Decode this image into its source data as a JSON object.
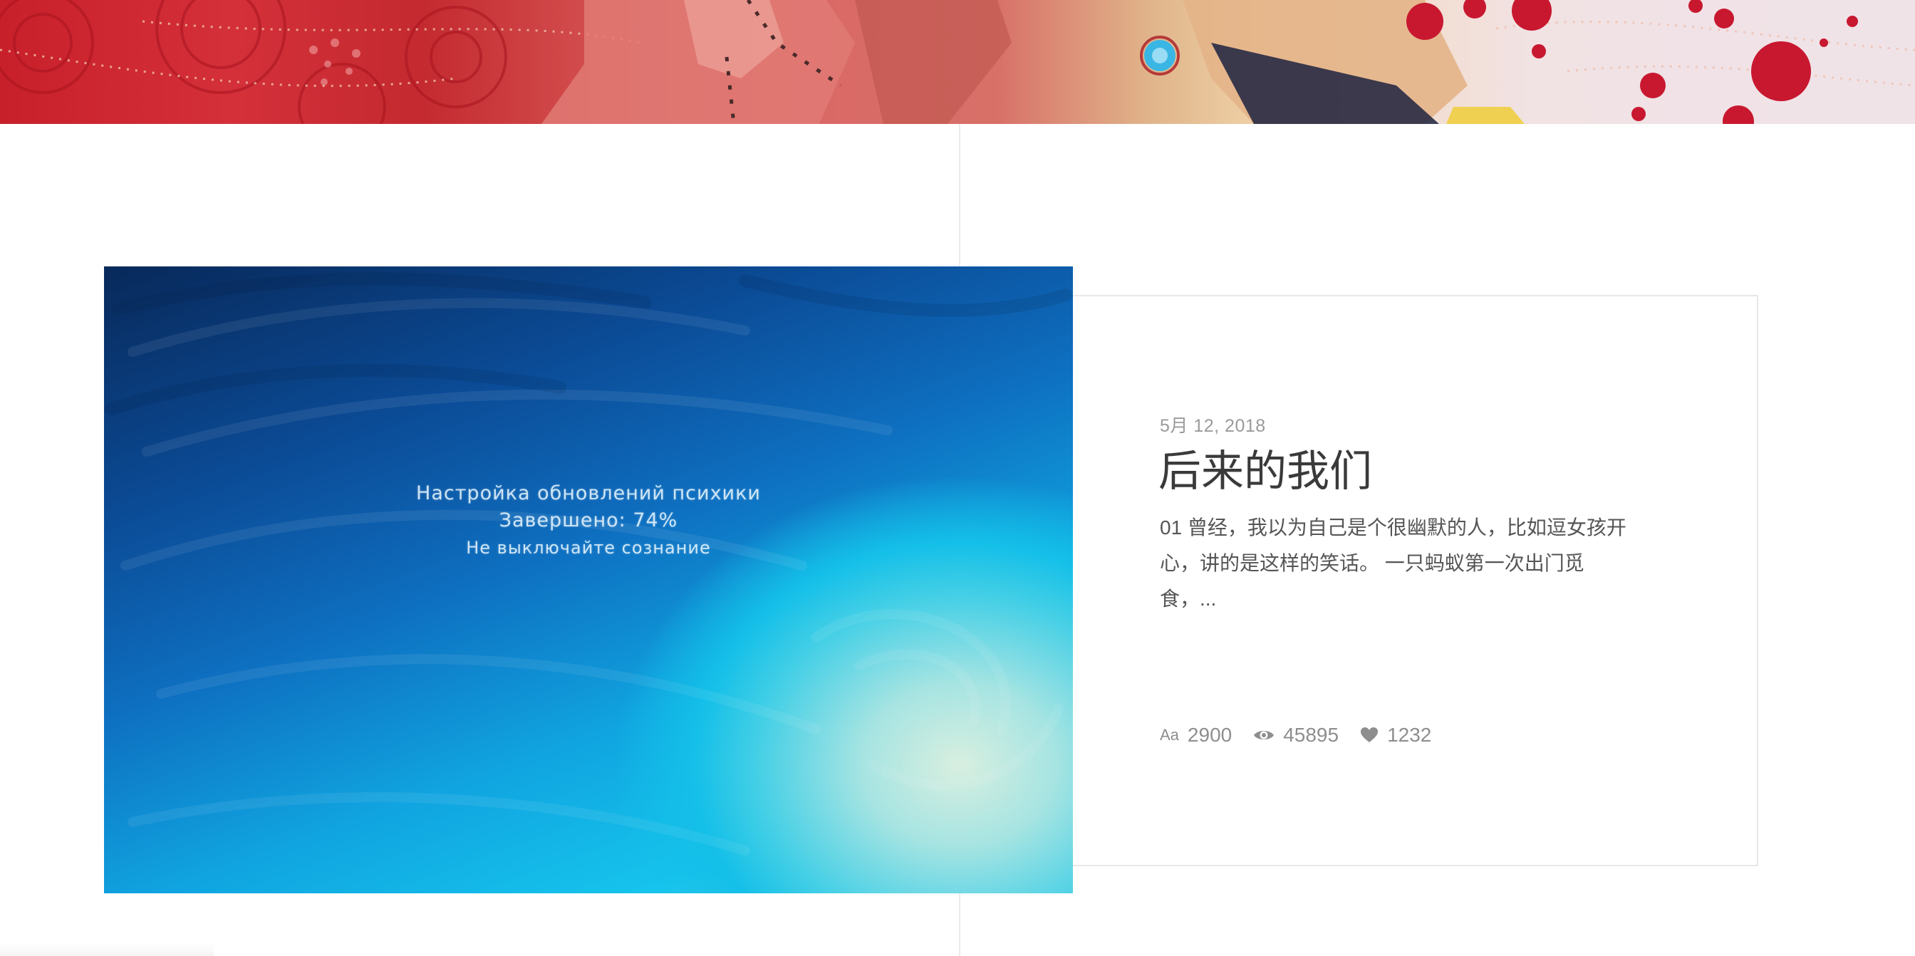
{
  "banner": {
    "alt": "decorative header illustration"
  },
  "post": {
    "image": {
      "caption_lines": [
        "Настройка обновлений психики",
        "Завершено: 74%",
        "Не выключайте сознание"
      ]
    },
    "date": "5月 12, 2018",
    "title": "后来的我们",
    "excerpt": "01 曾经，我以为自己是个很幽默的人，比如逗女孩开心，讲的是这样的笑话。 一只蚂蚁第一次出门觅食，...",
    "stats": {
      "words_label": "Aa",
      "words": "2900",
      "views": "45895",
      "likes": "1232"
    }
  },
  "icons": {
    "words": "font-size-icon",
    "views": "eye-icon",
    "likes": "heart-icon"
  },
  "colors": {
    "text_primary": "#3a3a3a",
    "text_muted": "#9a9a9a",
    "card_border": "#e8e8e8",
    "banner_red": "#c8202a"
  }
}
